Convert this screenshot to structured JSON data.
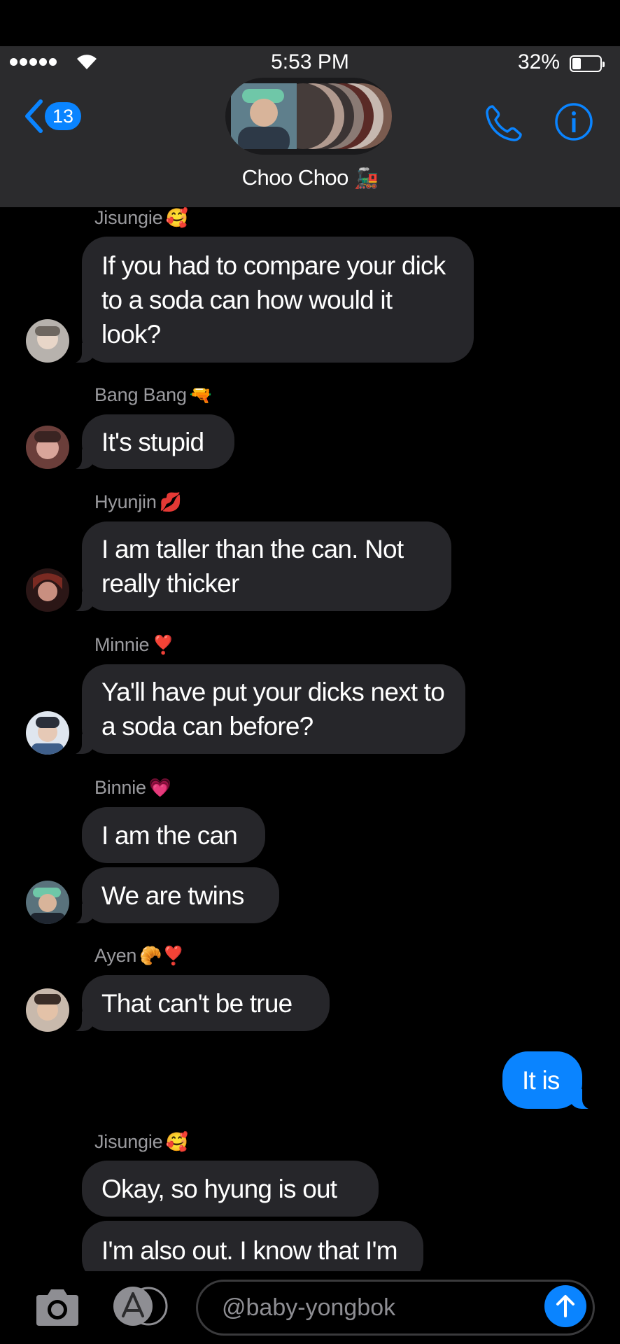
{
  "status_bar": {
    "time": "5:53 PM",
    "battery_percent": "32%",
    "battery_level": 0.32,
    "signal_dots": 5
  },
  "header": {
    "back_count": "13",
    "group_name": "Choo Choo",
    "group_emoji": "🚂",
    "accent_color": "#0a84ff"
  },
  "messages": [
    {
      "sender": "Jisungie",
      "sender_emoji": "🥰",
      "bubbles": [
        "If you had to compare your dick to a soda can how would it look?"
      ]
    },
    {
      "sender": "Bang Bang",
      "sender_emoji": "🔫",
      "bubbles": [
        "It's stupid"
      ]
    },
    {
      "sender": "Hyunjin",
      "sender_emoji": "💋",
      "bubbles": [
        "I am taller than the can. Not really thicker"
      ]
    },
    {
      "sender": "Minnie",
      "sender_emoji": "❣️",
      "bubbles": [
        "Ya'll have put your dicks next to a soda can before?"
      ]
    },
    {
      "sender": "Binnie",
      "sender_emoji": "💗",
      "bubbles": [
        "I am the can",
        "We are twins"
      ]
    },
    {
      "sender": "Ayen",
      "sender_emoji": "🥐❣️",
      "bubbles": [
        "That can't be true"
      ]
    },
    {
      "sender": "me",
      "bubbles": [
        "It is"
      ]
    },
    {
      "sender": "Jisungie",
      "sender_emoji": "🥰",
      "bubbles": [
        "Okay, so hyung is out",
        "I'm also out. I know that I'm"
      ]
    }
  ],
  "input": {
    "placeholder": "@baby-yongbok"
  }
}
